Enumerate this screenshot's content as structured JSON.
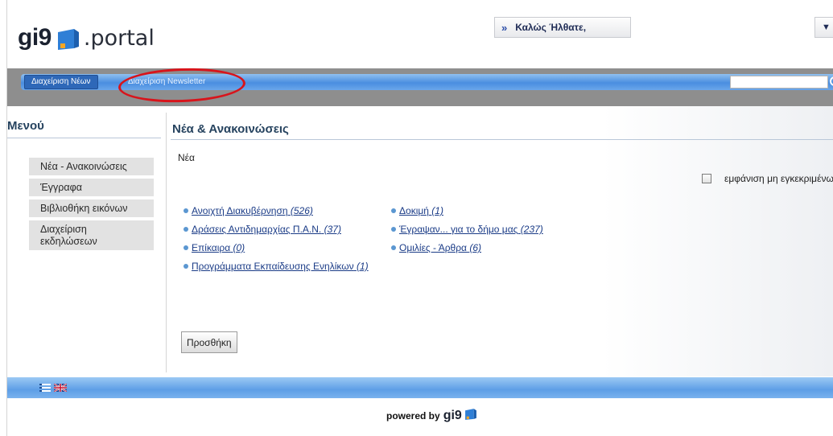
{
  "header": {
    "logo_text": "gi9",
    "logo_suffix": ".portal",
    "welcome_arrows": "»",
    "welcome_text": "Καλώς Ήλθατε,",
    "user_menu_caret": "▼"
  },
  "nav": {
    "tabs": [
      {
        "label": "Διαχείριση Νέων",
        "active": true
      },
      {
        "label": "Διαχείριση Newsletter",
        "active": false
      }
    ],
    "search_placeholder": ""
  },
  "sidebar": {
    "title": "Μενού",
    "items": [
      {
        "label": "Νέα - Ανακοινώσεις"
      },
      {
        "label": "Έγγραφα"
      },
      {
        "label": "Βιβλιοθήκη εικόνων"
      },
      {
        "label": "Διαχείριση εκδηλώσεων"
      }
    ]
  },
  "main": {
    "title": "Νέα & Ανακοινώσεις",
    "subtitle": "Νέα",
    "show_unapproved_label": "εμφάνιση μη εγκεκριμένων",
    "show_unapproved_checked": false,
    "categories_left": [
      {
        "name": "Ανοιχτή Διακυβέρνηση",
        "count": "(526)"
      },
      {
        "name": "Δράσεις Αντιδημαρχίας Π.Α.Ν.",
        "count": "(37)"
      },
      {
        "name": "Επίκαιρα",
        "count": "(0)"
      },
      {
        "name": "Προγράμματα Εκπαίδευσης Ενηλίκων",
        "count": "(1)"
      }
    ],
    "categories_right": [
      {
        "name": "Δοκιμή",
        "count": "(1)"
      },
      {
        "name": "Έγραψαν... για το δήμο μας",
        "count": "(237)"
      },
      {
        "name": "Ομιλίες - Άρθρα",
        "count": "(6)"
      }
    ],
    "add_button": "Προσθήκη"
  },
  "footer": {
    "powered_by": "powered by",
    "brand": "gi9"
  },
  "colors": {
    "nav_blue": "#4a8ee0",
    "link_blue": "#1b3c87",
    "highlight_red": "#d8141b",
    "heading_navy": "#26435f"
  }
}
